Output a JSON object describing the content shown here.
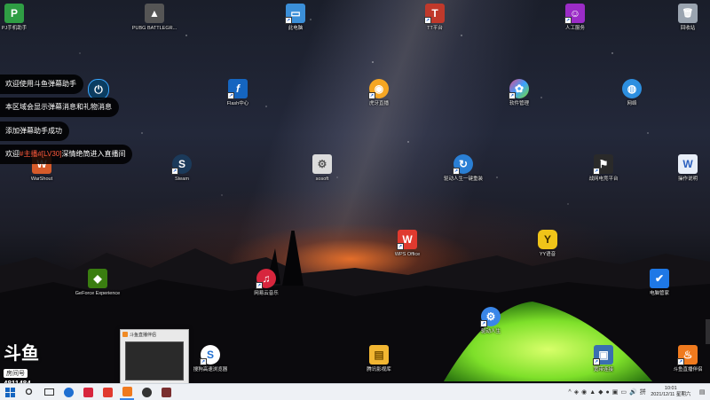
{
  "desktop_icons": [
    {
      "label": "PJ手机助手",
      "color": "#2f9e44",
      "glyph": "P"
    },
    {
      "label": "PUBG BATTLEGR...",
      "color": "#555555",
      "glyph": "▲"
    },
    {
      "label": "此电脑",
      "color": "#3b8fd8",
      "glyph": "▭"
    },
    {
      "label": "TT平台",
      "color": "#c0392b",
      "glyph": "T"
    },
    {
      "label": "人工服务",
      "color": "#9b2cc7",
      "glyph": "☺"
    },
    {
      "label": "回收站",
      "color": "#9aa4b0",
      "glyph": "🗑"
    },
    {
      "label": "Flash中心",
      "color": "#1565c0",
      "glyph": "f"
    },
    {
      "label": "虎牙直播",
      "color": "#f5a623",
      "glyph": "◉"
    },
    {
      "label": "软件管理",
      "color": "#e14b8a",
      "glyph": "✿"
    },
    {
      "label": "网络",
      "color": "#2d8fe0",
      "glyph": "◍"
    },
    {
      "label": "WarShout",
      "color": "#d65b2a",
      "glyph": "W"
    },
    {
      "label": "Steam",
      "color": "#1b3a5a",
      "glyph": "S"
    },
    {
      "label": "sosoft",
      "color": "#dcdcdc",
      "glyph": "⚙"
    },
    {
      "label": "驱动人生一键重装",
      "color": "#2a7fd4",
      "glyph": "↻"
    },
    {
      "label": "战网电竞平台",
      "color": "#2a2a2a",
      "glyph": "⚑"
    },
    {
      "label": "操作说明",
      "color": "#e8eef8",
      "glyph": "W"
    },
    {
      "label": "WPS Office",
      "color": "#e03a2f",
      "glyph": "W"
    },
    {
      "label": "YY语音",
      "color": "#f0c419",
      "glyph": "Y"
    },
    {
      "label": "GeForce Experience",
      "color": "#3a7d10",
      "glyph": "◆"
    },
    {
      "label": "网易云音乐",
      "color": "#d7263d",
      "glyph": "♫"
    },
    {
      "label": "电脑管家",
      "color": "#1e78e6",
      "glyph": "✔"
    },
    {
      "label": "驱动人生",
      "color": "#3a86e8",
      "glyph": "⚙"
    },
    {
      "label": "搜狗高速浏览器",
      "color": "#1f6fd1",
      "glyph": "S"
    },
    {
      "label": "腾讯影视库",
      "color": "#f2b632",
      "glyph": "▤"
    },
    {
      "label": "宽带连接",
      "color": "#3a6fb0",
      "glyph": "▣"
    },
    {
      "label": "斗鱼直播伴侣",
      "color": "#f07a1e",
      "glyph": "♨"
    }
  ],
  "chat_messages": [
    {
      "text": "欢迎使用斗鱼弹幕助手"
    },
    {
      "text": "本区域会显示弹幕消息和礼物消息"
    },
    {
      "text": "添加弹幕助手成功"
    },
    {
      "prefix": "欢迎",
      "highlight": "#主播#",
      "level": "[LV30]",
      "rest": "深情绝筒进入直播间"
    }
  ],
  "brand": {
    "logo": "斗鱼",
    "tag": "房间号",
    "room_id": "4811484"
  },
  "taskbar_preview": {
    "title": "斗鱼直播伴侣"
  },
  "taskbar": {
    "apps": [
      {
        "name": "start",
        "color": "#1565c0"
      },
      {
        "name": "search",
        "color": "#333333"
      },
      {
        "name": "task-view",
        "color": "#333333"
      },
      {
        "name": "sogou",
        "color": "#1f6fd1"
      },
      {
        "name": "netease",
        "color": "#d7263d"
      },
      {
        "name": "wps",
        "color": "#e03a2f"
      },
      {
        "name": "douyu",
        "color": "#f07a1e"
      },
      {
        "name": "obs",
        "color": "#333333"
      },
      {
        "name": "game",
        "color": "#7a2f2f"
      }
    ],
    "clock_time": "10:01",
    "clock_date": "2021/12/11 星期六"
  }
}
